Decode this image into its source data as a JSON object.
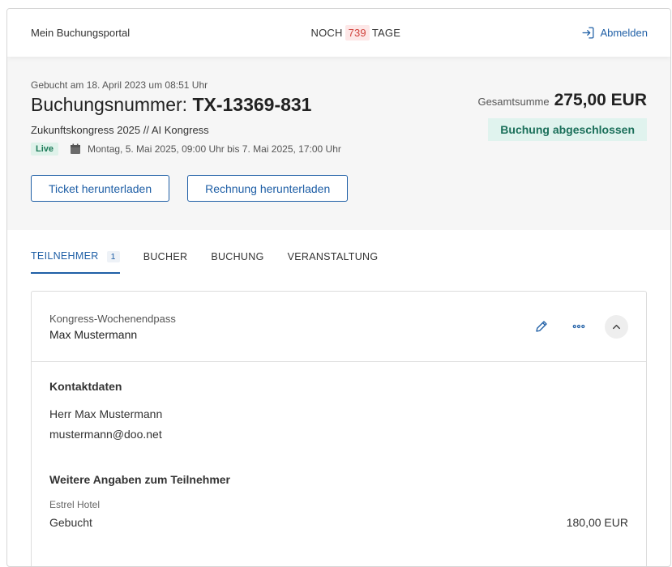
{
  "topbar": {
    "portal_title": "Mein Buchungsportal",
    "countdown_prefix": "NOCH",
    "countdown_days": "739",
    "countdown_suffix": "TAGE",
    "logout_label": "Abmelden"
  },
  "booking": {
    "booked_on": "Gebucht am 18. April 2023 um 08:51 Uhr",
    "number_label": "Buchungsnummer:",
    "number": "TX-13369-831",
    "event_name": "Zukunftskongress 2025 // AI Kongress",
    "live_badge": "Live",
    "event_dates": "Montag, 5. Mai 2025, 09:00 Uhr bis 7. Mai 2025, 17:00 Uhr",
    "total_label": "Gesamtsumme",
    "total_amount": "275,00 EUR",
    "status": "Buchung abgeschlossen",
    "download_ticket": "Ticket herunterladen",
    "download_invoice": "Rechnung herunterladen"
  },
  "tabs": [
    {
      "label": "TEILNEHMER",
      "count": "1"
    },
    {
      "label": "BUCHER"
    },
    {
      "label": "BUCHUNG"
    },
    {
      "label": "VERANSTALTUNG"
    }
  ],
  "participant": {
    "ticket_type": "Kongress-Wochenendpass",
    "name": "Max Mustermann",
    "contact_title": "Kontaktdaten",
    "contact_name": "Herr Max Mustermann",
    "contact_email": "mustermann@doo.net",
    "extra_title": "Weitere Angaben zum Teilnehmer",
    "hotel_label": "Estrel Hotel",
    "hotel_status": "Gebucht",
    "hotel_price": "180,00 EUR"
  },
  "colors": {
    "accent": "#1f5fa6",
    "countdown": "#d0413b",
    "status_bg": "#e0f3ee",
    "status_text": "#1b6f5a"
  }
}
